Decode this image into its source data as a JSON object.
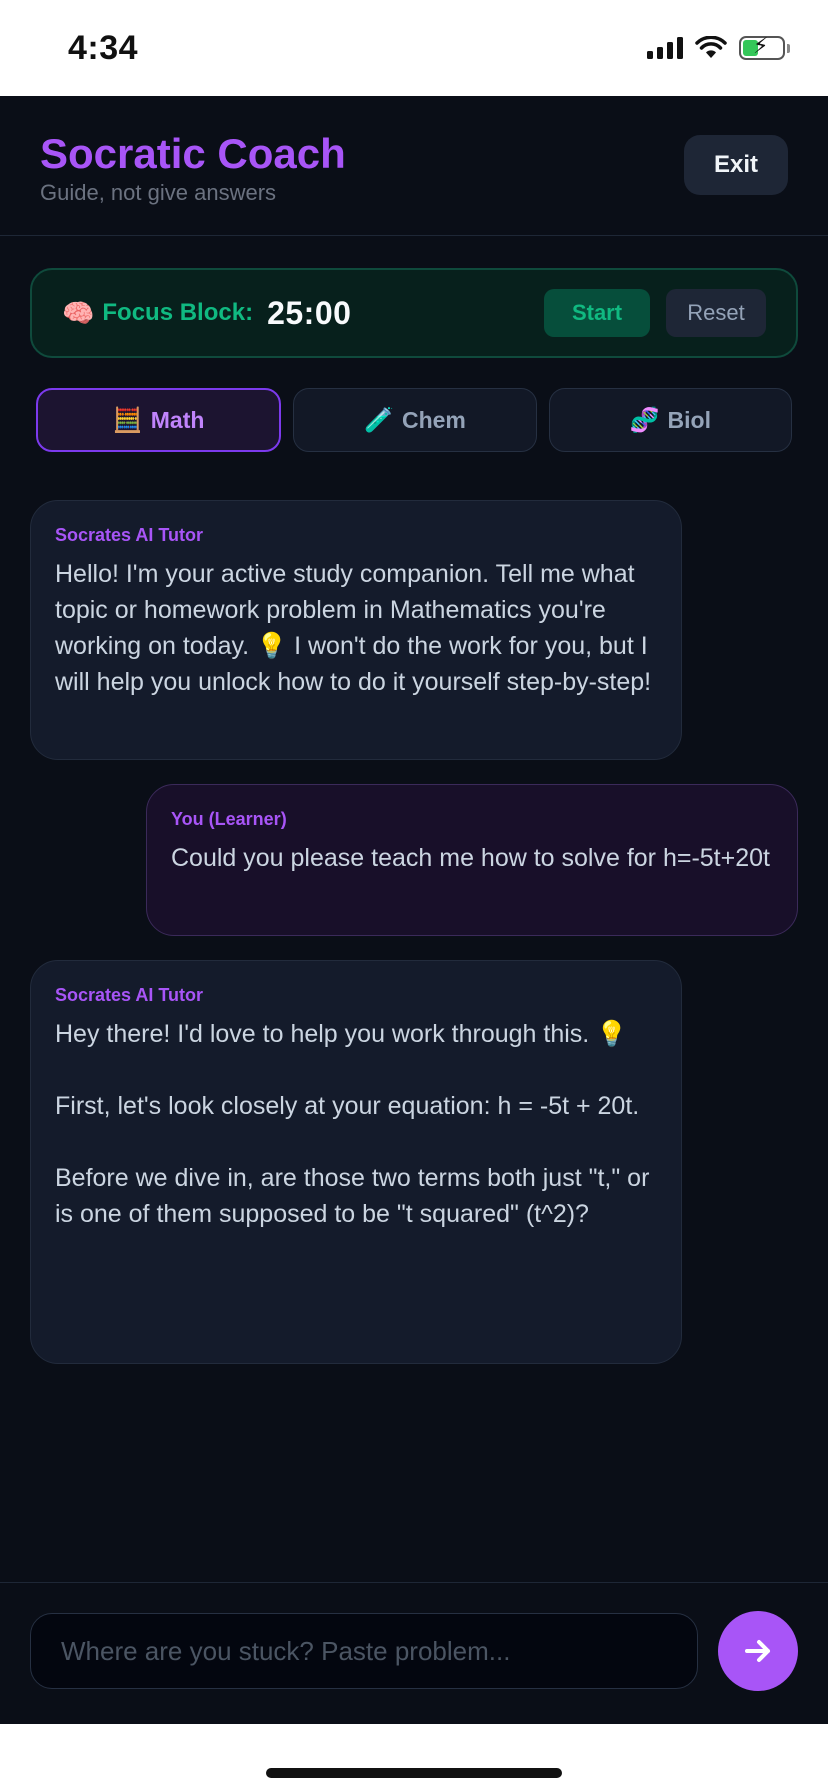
{
  "status_bar": {
    "time": "4:34",
    "icons": [
      "signal-icon",
      "wifi-icon",
      "battery-charging-icon"
    ]
  },
  "header": {
    "title": "Socratic Coach",
    "subtitle": "Guide, not give answers",
    "exit_label": "Exit"
  },
  "focus": {
    "icon": "🧠",
    "label": "Focus Block:",
    "timer": "25:00",
    "start_label": "Start",
    "reset_label": "Reset"
  },
  "subjects": [
    {
      "icon": "🧮",
      "label": "Math",
      "active": true
    },
    {
      "icon": "🧪",
      "label": "Chem",
      "active": false
    },
    {
      "icon": "🧬",
      "label": "Biol",
      "active": false
    }
  ],
  "messages": [
    {
      "sender": "Socrates AI Tutor",
      "role": "ai",
      "text": "Hello! I'm your active study companion. Tell me what topic or homework problem in Mathematics you're working on today. 💡 I won't do the work for you, but I will help you unlock how to do it yourself step-by-step!"
    },
    {
      "sender": "You (Learner)",
      "role": "user",
      "text": "Could you please teach me how to solve for h=-5t+20t"
    },
    {
      "sender": "Socrates AI Tutor",
      "role": "ai",
      "text": "Hey there! I'd love to help you work through this. 💡\n\nFirst, let's look closely at your equation: h = -5t + 20t.\n\nBefore we dive in, are those two terms both just \"t,\" or is one of them supposed to be \"t squared\" (t^2)?"
    }
  ],
  "composer": {
    "placeholder": "Where are you stuck? Paste problem...",
    "value": "",
    "send_icon": "arrow-right-icon"
  },
  "colors": {
    "accent": "#a855f7",
    "focus_green": "#10b981",
    "background": "#0a0e17"
  }
}
